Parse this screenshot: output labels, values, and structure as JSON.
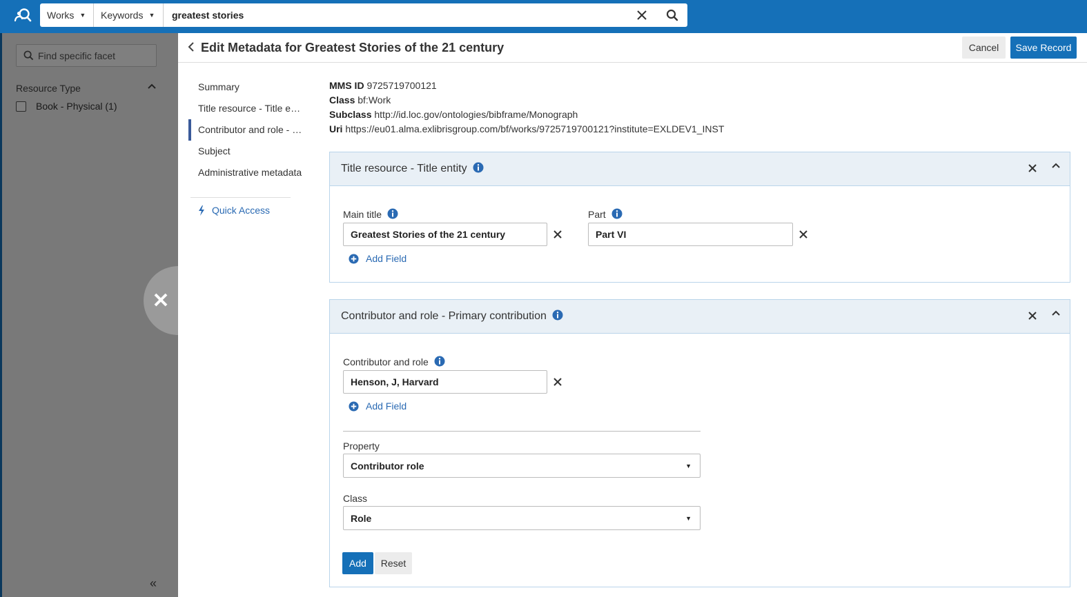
{
  "topbar": {
    "logo_icon": "search-people-icon",
    "scope": "Works",
    "search_type": "Keywords",
    "query": "greatest stories"
  },
  "facets": {
    "search_placeholder": "Find specific facet",
    "group_title": "Resource Type",
    "items": [
      {
        "label": "Book - Physical",
        "count": "(1)"
      }
    ]
  },
  "header": {
    "title": "Edit Metadata for Greatest Stories of the 21 century",
    "cancel_label": "Cancel",
    "save_label": "Save Record"
  },
  "section_nav": {
    "items": [
      {
        "label": "Summary",
        "active": false
      },
      {
        "label": "Title resource - Title entity",
        "active": false
      },
      {
        "label": "Contributor and role - Primary contribution",
        "active": true
      },
      {
        "label": "Subject",
        "active": false
      },
      {
        "label": "Administrative metadata",
        "active": false
      }
    ],
    "quick_access": "Quick Access"
  },
  "record": {
    "mms_label": "MMS ID",
    "mms_value": "9725719700121",
    "class_label": "Class",
    "class_value": "bf:Work",
    "subclass_label": "Subclass",
    "subclass_value": "http://id.loc.gov/ontologies/bibframe/Monograph",
    "uri_label": "Uri",
    "uri_value": "https://eu01.alma.exlibrisgroup.com/bf/works/9725719700121?institute=EXLDEV1_INST"
  },
  "title_card": {
    "title": "Title resource - Title entity",
    "main_title_label": "Main title",
    "main_title_value": "Greatest Stories of the 21 century",
    "part_label": "Part",
    "part_value": "Part VI",
    "add_field": "Add Field"
  },
  "contrib_card": {
    "title": "Contributor and role - Primary contribution",
    "field_label": "Contributor and role",
    "field_value": "Henson, J, Harvard",
    "add_field": "Add Field",
    "property_label": "Property",
    "property_value": "Contributor role",
    "class_label": "Class",
    "class_value": "Role",
    "add_label": "Add",
    "reset_label": "Reset"
  },
  "colors": {
    "brand": "#1570b8",
    "link": "#2a6ab3",
    "card_header": "#e9f0f6"
  }
}
